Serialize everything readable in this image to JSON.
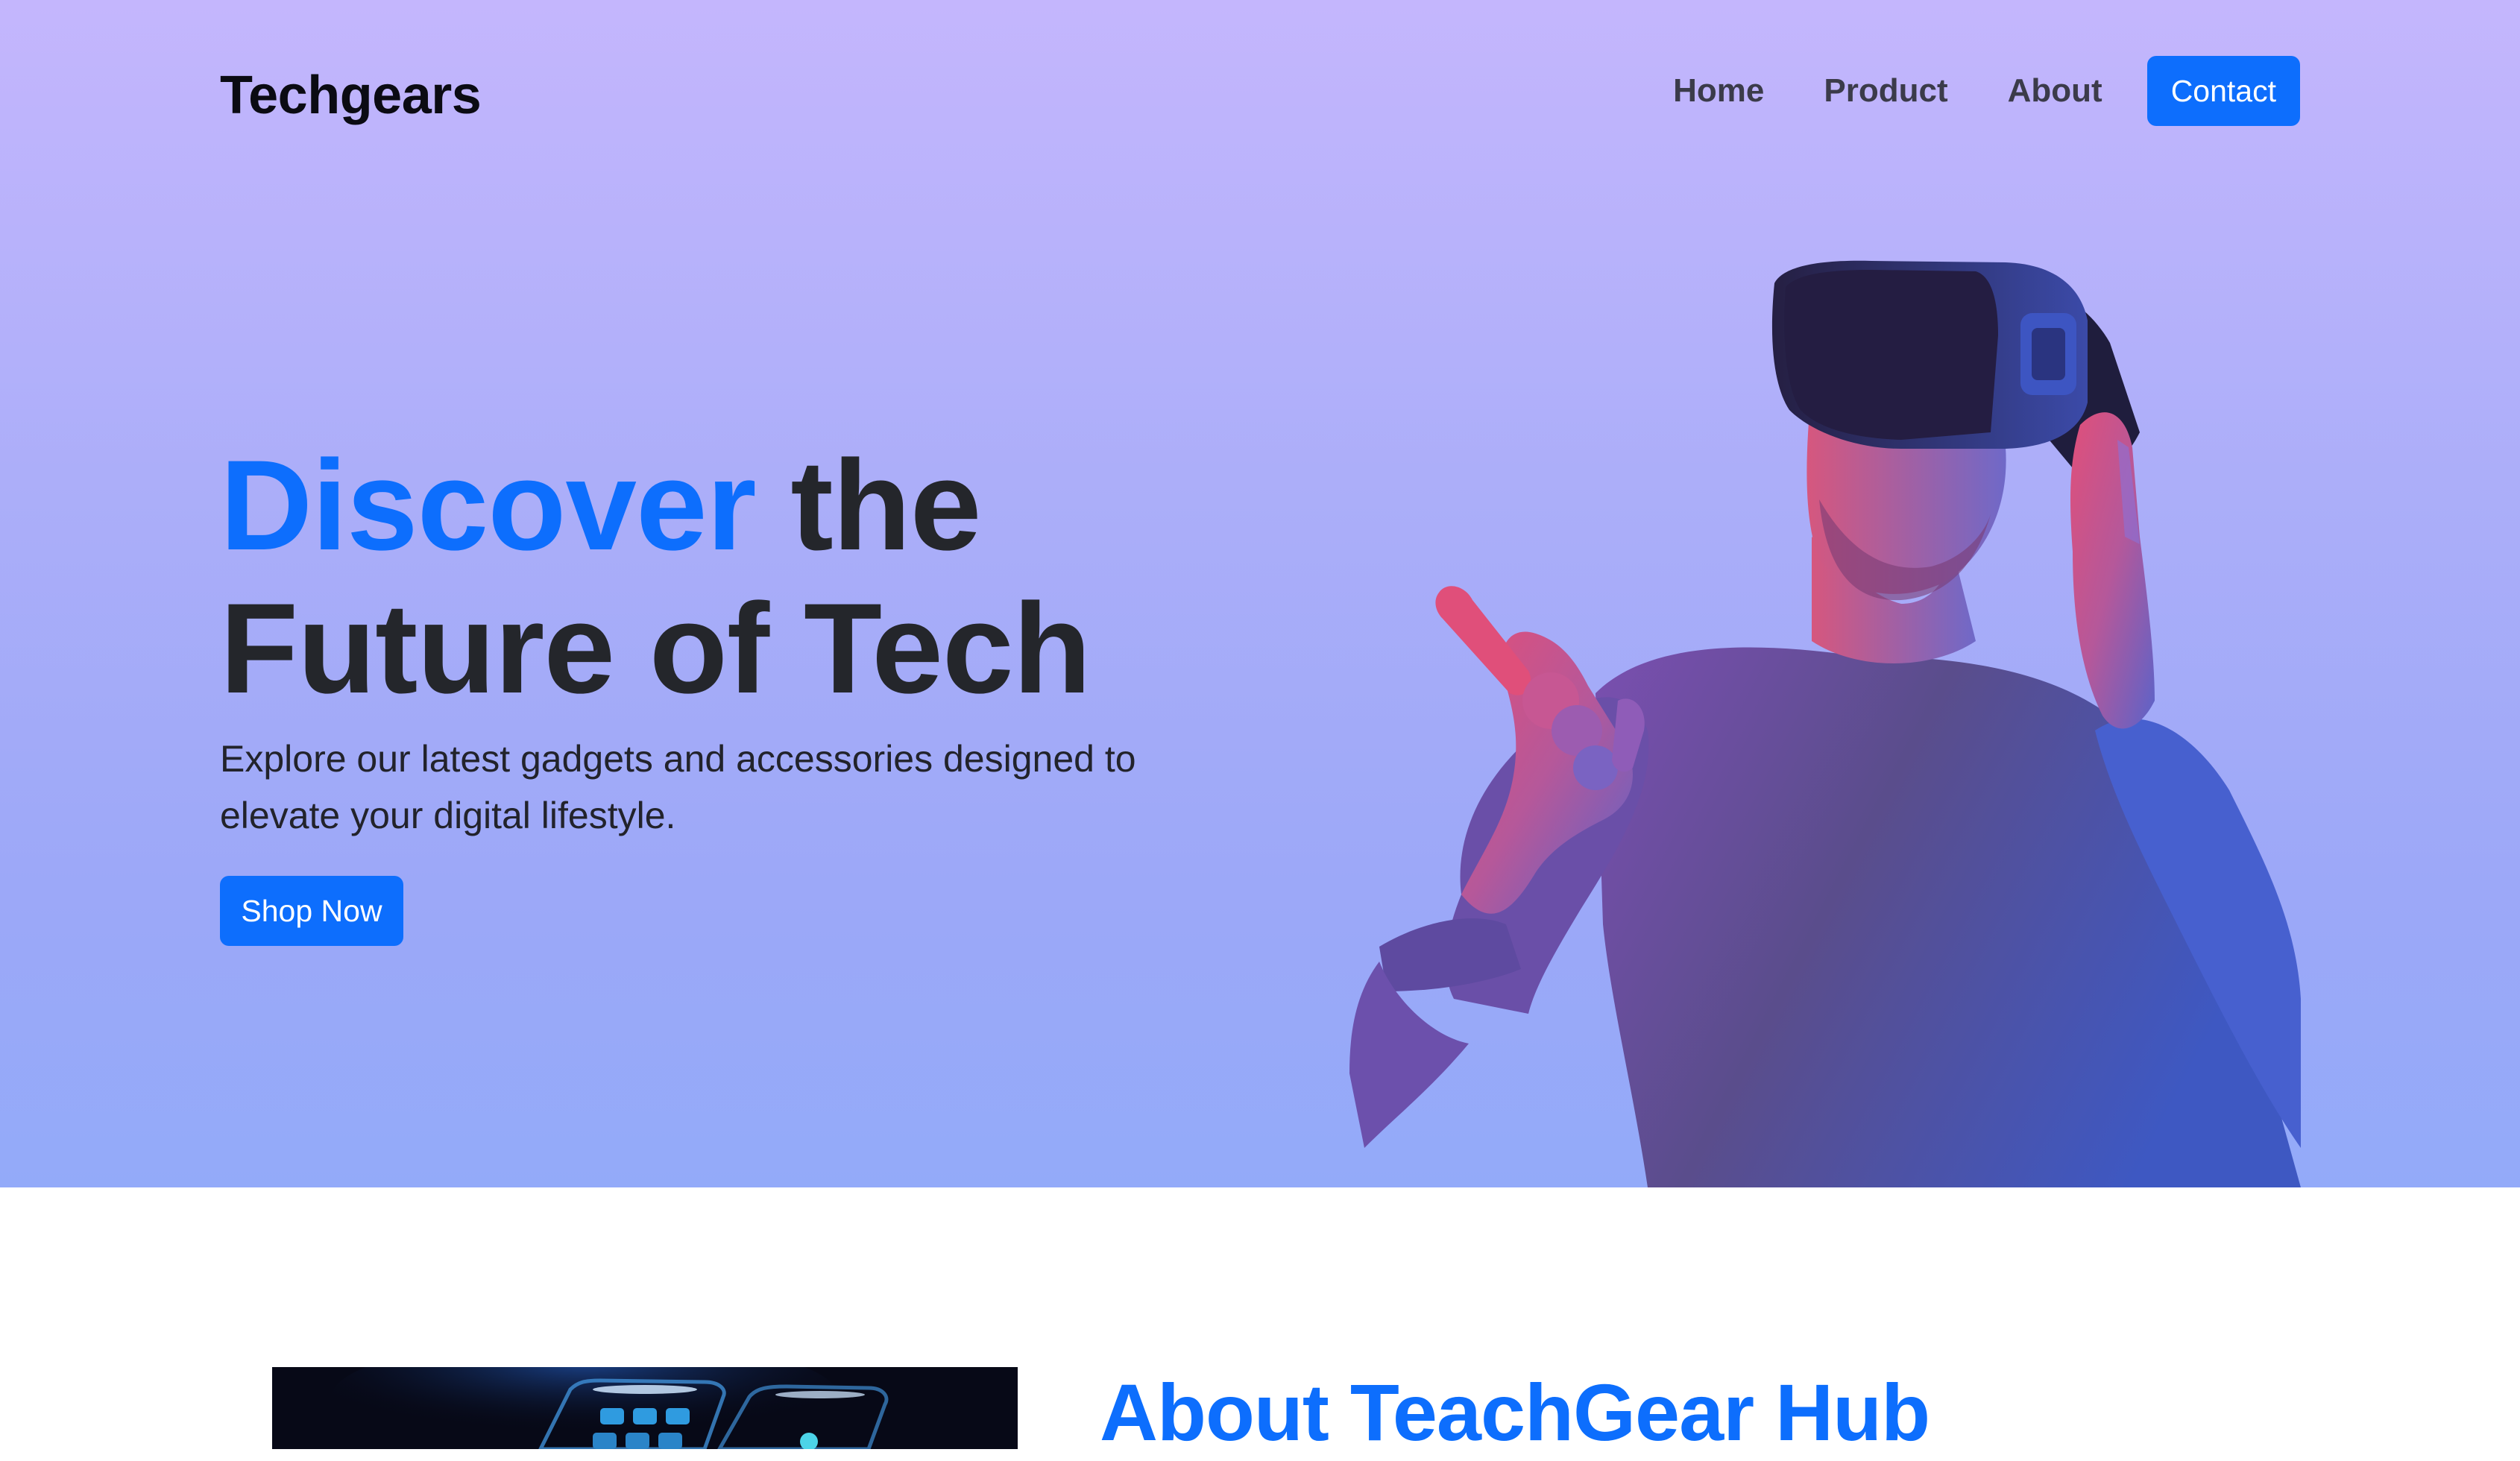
{
  "header": {
    "brand": "Techgears",
    "nav": {
      "home": "Home",
      "product": "Product",
      "about": "About",
      "contact": "Contact"
    }
  },
  "hero": {
    "headline_accent": "Discover",
    "headline_rest_line1": " the",
    "headline_line2": "Future of Tech",
    "description": "Explore our latest gadgets and accessories designed to elevate your digital lifestyle.",
    "cta": "Shop Now"
  },
  "about": {
    "title": "About TeachGear Hub"
  },
  "colors": {
    "accent": "#0d6efd",
    "hero_gradient_top": "#c4b6fd",
    "hero_gradient_bottom": "#93aaf9",
    "heading_dark": "#24262b"
  }
}
